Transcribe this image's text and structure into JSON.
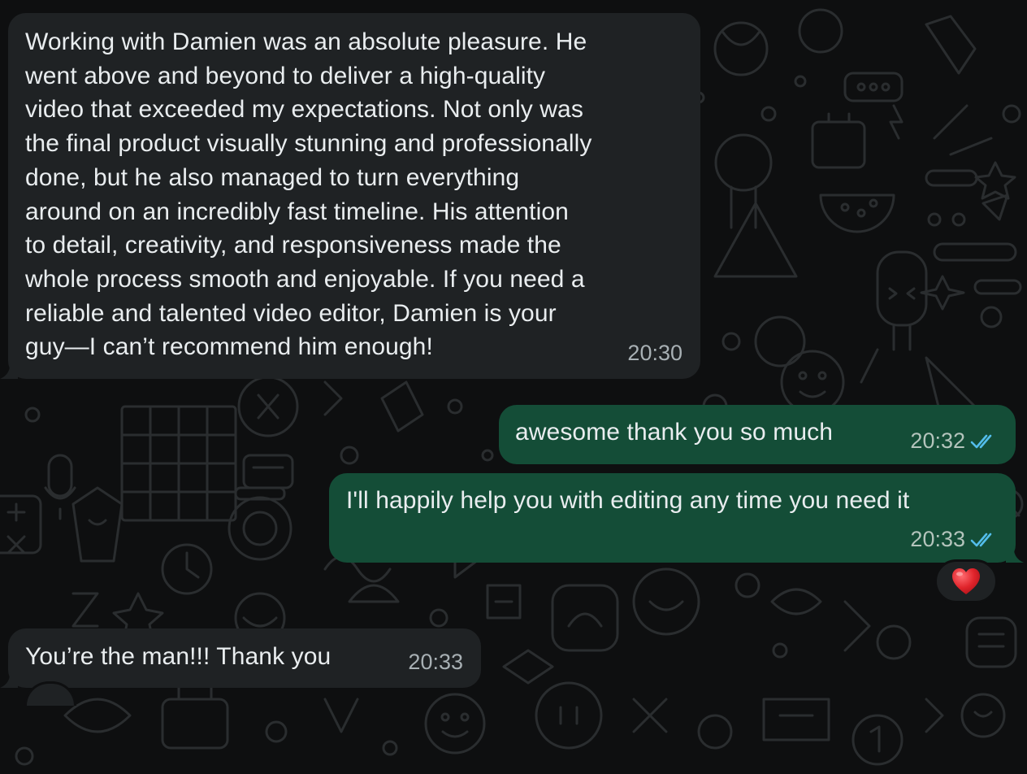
{
  "messages": [
    {
      "direction": "incoming",
      "text": "Working with Damien was an absolute pleasure. He\nwent above and beyond to deliver a high-quality\nvideo that exceeded my expectations. Not only was\nthe final product visually stunning and professionally\ndone, but he also managed to turn everything\naround on an incredibly fast timeline. His attention\nto detail, creativity, and responsiveness made the\nwhole process smooth and enjoyable. If you need a\nreliable and talented video editor, Damien is your\nguy—I can’t recommend him enough!",
      "time": "20:30"
    },
    {
      "direction": "outgoing",
      "text": "awesome thank you so much",
      "time": "20:32",
      "status": "read"
    },
    {
      "direction": "outgoing",
      "text": "I'll happily help you with editing any time you need it",
      "time": "20:33",
      "status": "read",
      "reaction": "heart"
    },
    {
      "direction": "incoming",
      "text": "You’re the man!!! Thank you",
      "time": "20:33"
    }
  ],
  "colors": {
    "background": "#0e0f10",
    "incoming_bubble": "#1f2224",
    "outgoing_bubble": "#144d37",
    "read_ticks": "#53bdeb",
    "reaction_heart": "#e0242b"
  },
  "icons": {
    "read_receipt": "double-check-icon",
    "reaction": "heart-icon"
  }
}
